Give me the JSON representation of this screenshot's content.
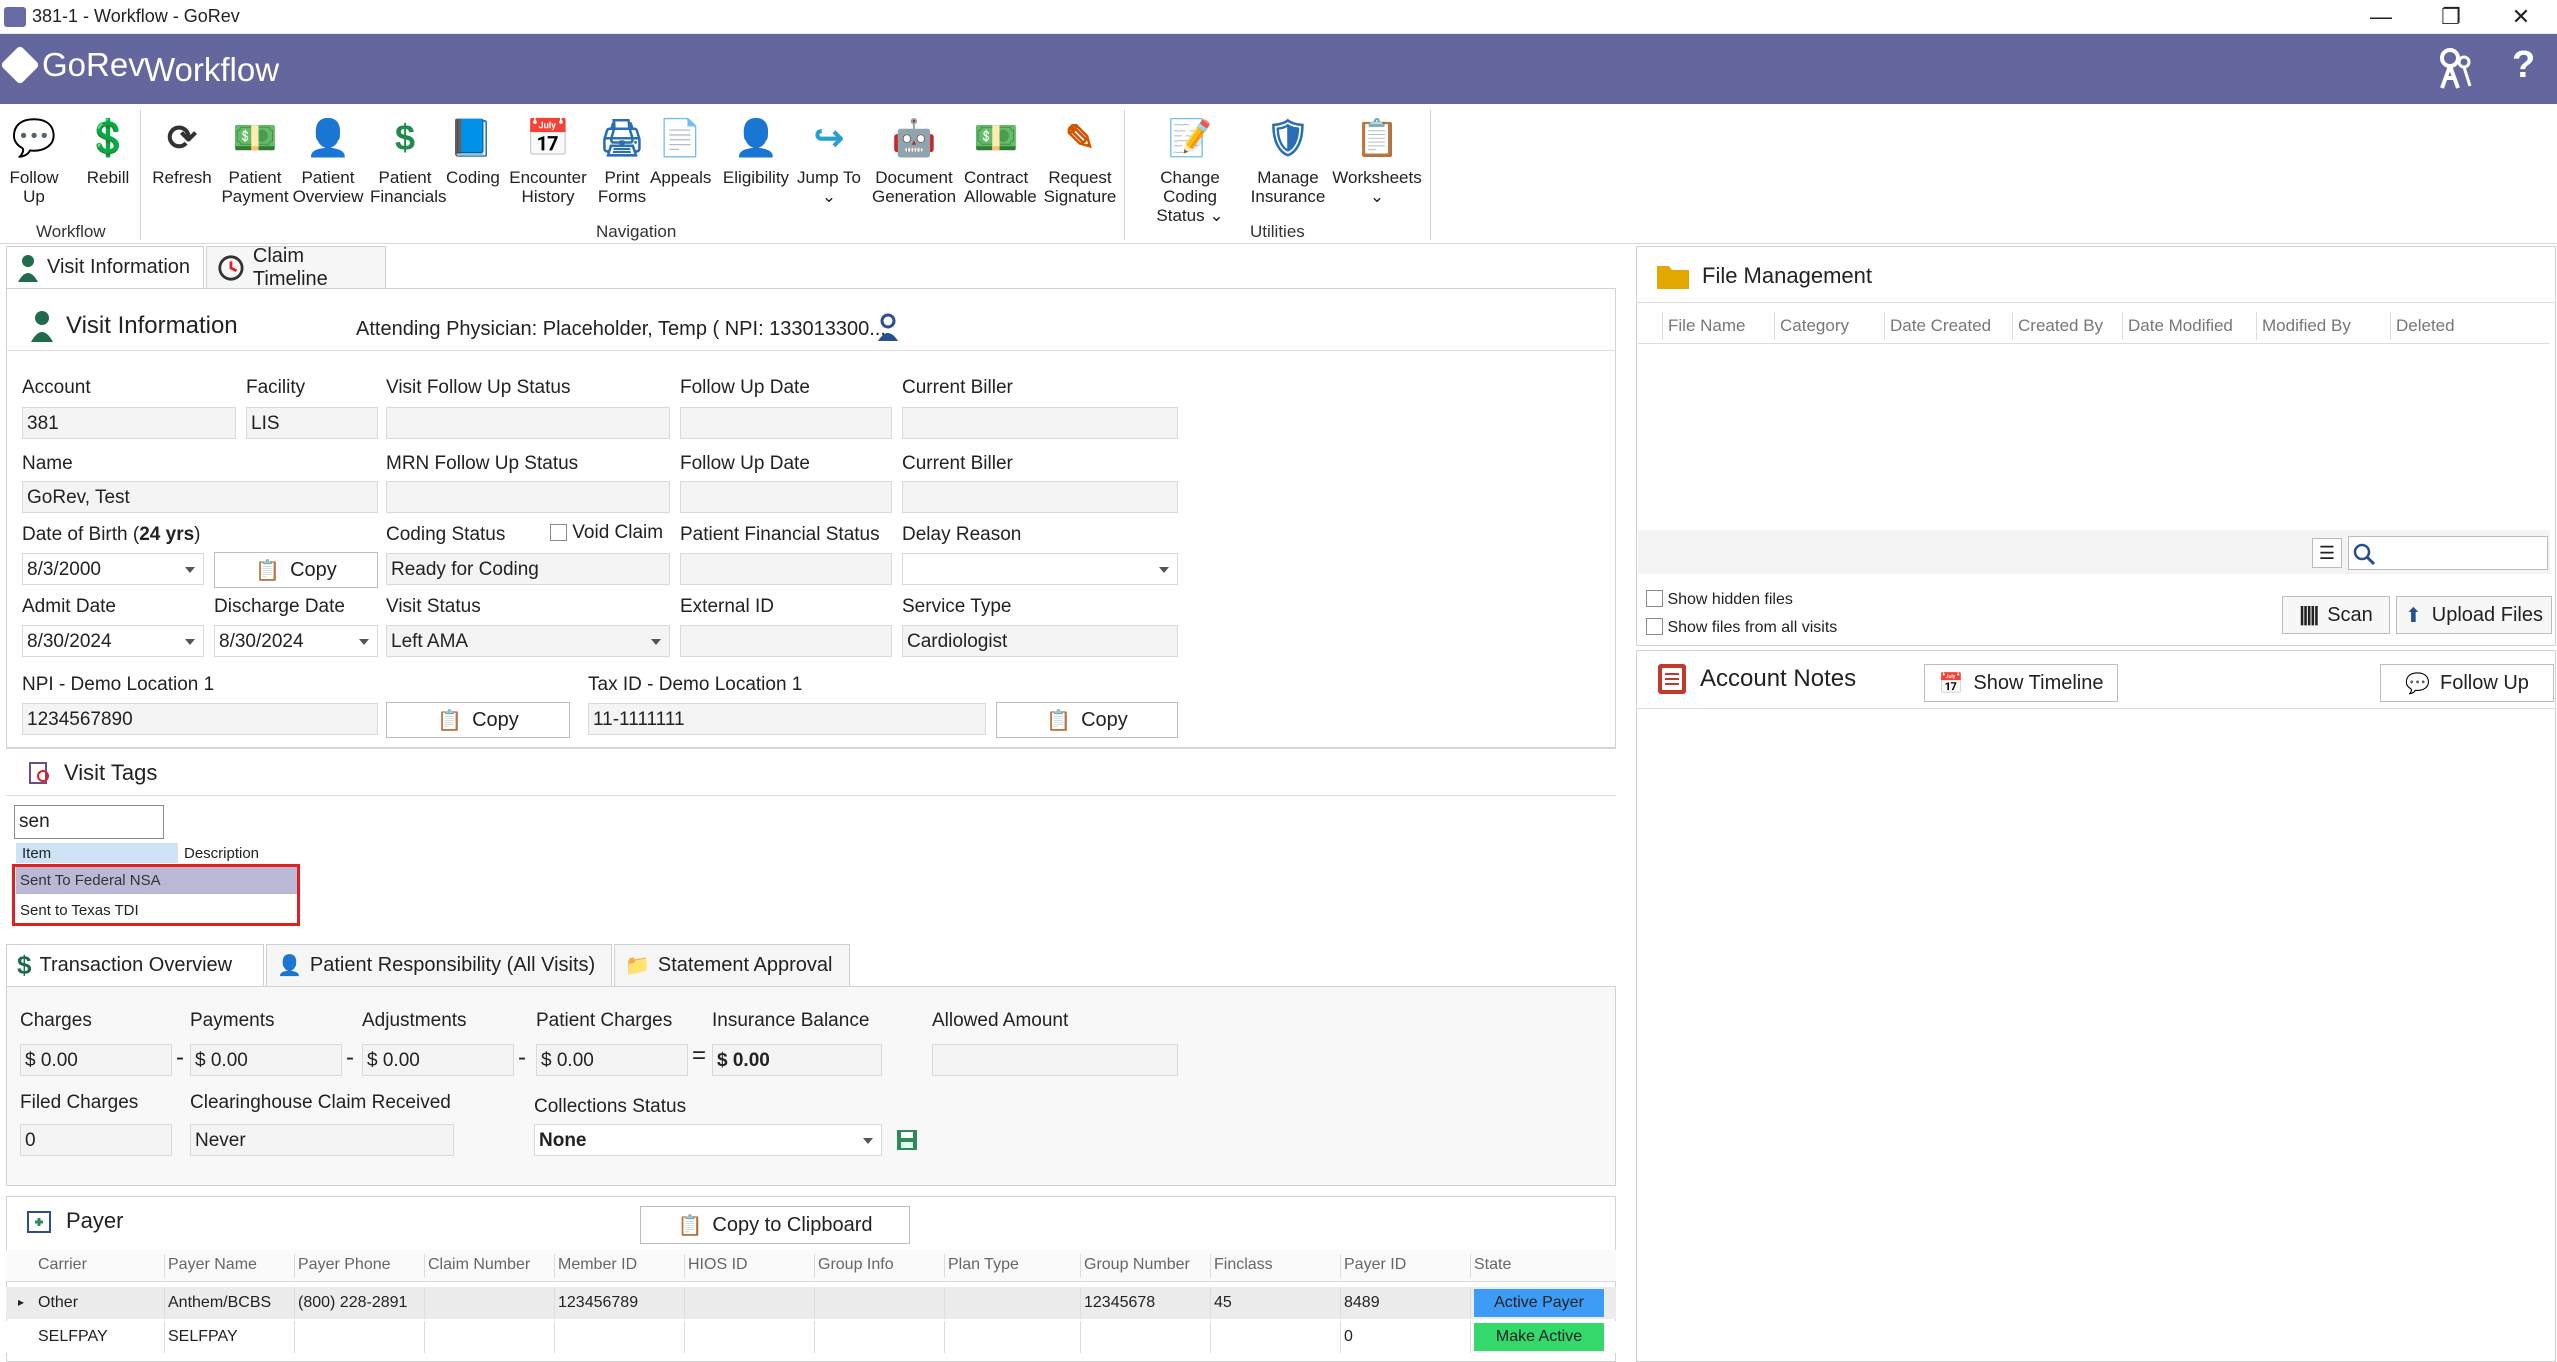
{
  "window": {
    "title": "381-1 - Workflow - GoRev",
    "minimize": "—",
    "restore": "❐",
    "close": "✕"
  },
  "header": {
    "logo": "GoRev",
    "title": "Workflow",
    "key_icon": "key-icon",
    "help": "?"
  },
  "ribbon": {
    "buttons": [
      {
        "l1": "Follow",
        "l2": "Up",
        "icon": "chat"
      },
      {
        "l1": "Rebill",
        "l2": "",
        "icon": "dollar-refresh"
      },
      {
        "l1": "Refresh",
        "l2": "",
        "icon": "refresh"
      },
      {
        "l1": "Patient",
        "l2": "Payment",
        "icon": "money"
      },
      {
        "l1": "Patient",
        "l2": "Overview",
        "icon": "person"
      },
      {
        "l1": "Patient",
        "l2": "Financials",
        "icon": "dollar"
      },
      {
        "l1": "Coding",
        "l2": "",
        "icon": "book"
      },
      {
        "l1": "Encounter",
        "l2": "History",
        "icon": "calendar"
      },
      {
        "l1": "Print",
        "l2": "Forms",
        "icon": "printer"
      },
      {
        "l1": "Appeals",
        "l2": "",
        "icon": "docs"
      },
      {
        "l1": "Eligibility",
        "l2": "",
        "icon": "person-check"
      },
      {
        "l1": "Jump To",
        "l2": "⌄",
        "icon": "arrow"
      },
      {
        "l1": "Document",
        "l2": "Generation",
        "icon": "robot"
      },
      {
        "l1": "Contract",
        "l2": "Allowable",
        "icon": "money-doc"
      },
      {
        "l1": "Request",
        "l2": "Signature",
        "icon": "pen"
      },
      {
        "l1": "Change Coding",
        "l2": "Status ⌄",
        "icon": "doc-pen"
      },
      {
        "l1": "Manage",
        "l2": "Insurance",
        "icon": "shield"
      },
      {
        "l1": "Worksheets",
        "l2": "⌄",
        "icon": "sheets"
      }
    ],
    "groups": {
      "workflow": "Workflow",
      "navigation": "Navigation",
      "utilities": "Utilities"
    }
  },
  "tabs": {
    "visit_info": "Visit Information",
    "claim_timeline": "Claim Timeline"
  },
  "visit": {
    "section_title": "Visit Information",
    "attending": "Attending Physician: Placeholder, Temp ( NPI: 133013300...",
    "labels": {
      "account": "Account",
      "facility": "Facility",
      "visit_fu_status": "Visit Follow Up Status",
      "fu_date": "Follow Up Date",
      "current_biller": "Current Biller",
      "name": "Name",
      "mrn_fu_status": "MRN Follow Up Status",
      "dob": "Date of Birth (",
      "dob_age": "24 yrs",
      "dob_close": ")",
      "coding_status": "Coding Status",
      "void_claim": "Void Claim",
      "patient_fin_status": "Patient Financial Status",
      "delay_reason": "Delay Reason",
      "admit_date": "Admit Date",
      "discharge_date": "Discharge Date",
      "visit_status": "Visit Status",
      "external_id": "External ID",
      "service_type": "Service Type",
      "npi": "NPI - Demo Location 1",
      "tax_id": "Tax ID - Demo Location 1"
    },
    "values": {
      "account": "381",
      "facility": "LIS",
      "visit_fu_status": "",
      "fu_date": "",
      "current_biller": "",
      "name": "GoRev, Test",
      "mrn_fu_status": "",
      "fu_date2": "",
      "current_biller2": "",
      "dob": "8/3/2000",
      "coding_status": "Ready for Coding",
      "patient_fin_status": "",
      "delay_reason": "",
      "admit_date": "8/30/2024",
      "discharge_date": "8/30/2024",
      "visit_status": "Left AMA",
      "external_id": "",
      "service_type": "Cardiologist",
      "npi": "1234567890",
      "tax_id": "11-1111111"
    },
    "copy": "Copy"
  },
  "tags": {
    "title": "Visit Tags",
    "search_value": "sen",
    "headers": {
      "item": "Item",
      "description": "Description"
    },
    "rows": [
      {
        "item": "Sent To Federal NSA",
        "description": ""
      },
      {
        "item": "Sent to Texas TDI",
        "description": ""
      }
    ]
  },
  "txn_tabs": {
    "overview": "Transaction Overview",
    "patient_resp": "Patient Responsibility (All Visits)",
    "statement": "Statement Approval"
  },
  "txn": {
    "labels": {
      "charges": "Charges",
      "payments": "Payments",
      "adjustments": "Adjustments",
      "patient_charges": "Patient Charges",
      "insurance_balance": "Insurance Balance",
      "allowed_amount": "Allowed Amount",
      "filed_charges": "Filed Charges",
      "ch_claim_received": "Clearinghouse Claim Received",
      "collections_status": "Collections Status"
    },
    "values": {
      "charges": "$ 0.00",
      "payments": "$ 0.00",
      "adjustments": "$ 0.00",
      "patient_charges": "$ 0.00",
      "insurance_balance": "$ 0.00",
      "allowed_amount": "",
      "filed_charges": "0",
      "ch_claim_received": "Never",
      "collections_status": "None"
    },
    "ops": {
      "minus": "-",
      "equals": "="
    }
  },
  "payer": {
    "title": "Payer",
    "copy": "Copy to Clipboard",
    "headers": [
      "Carrier",
      "Payer Name",
      "Payer Phone",
      "Claim Number",
      "Member ID",
      "HIOS ID",
      "Group Info",
      "Plan Type",
      "Group Number",
      "Finclass",
      "Payer ID",
      "State"
    ],
    "rows": [
      {
        "carrier": "Other",
        "payer_name": "Anthem/BCBS",
        "phone": "(800) 228-2891",
        "claim": "",
        "member": "123456789",
        "hios": "",
        "group_info": "",
        "plan": "",
        "group_number": "12345678",
        "finclass": "45",
        "payer_id": "8489",
        "state": "Active Payer"
      },
      {
        "carrier": "SELFPAY",
        "payer_name": "SELFPAY",
        "phone": "",
        "claim": "",
        "member": "",
        "hios": "",
        "group_info": "",
        "plan": "",
        "group_number": "",
        "finclass": "",
        "payer_id": "0",
        "state": "Make Active"
      }
    ],
    "state_colors": {
      "active": "#3d9cf5",
      "make_active": "#33d96a"
    }
  },
  "files": {
    "title": "File Management",
    "headers": [
      "File Name",
      "Category",
      "Date Created",
      "Created By",
      "Date Modified",
      "Modified By",
      "Deleted"
    ],
    "show_hidden": "Show hidden files",
    "show_all": "Show files from all visits",
    "scan": "Scan",
    "upload": "Upload Files"
  },
  "notes": {
    "title": "Account Notes",
    "show_timeline": "Show Timeline",
    "follow_up": "Follow Up"
  },
  "colors": {
    "brand": "#64679d",
    "highlight": "#e02020"
  }
}
